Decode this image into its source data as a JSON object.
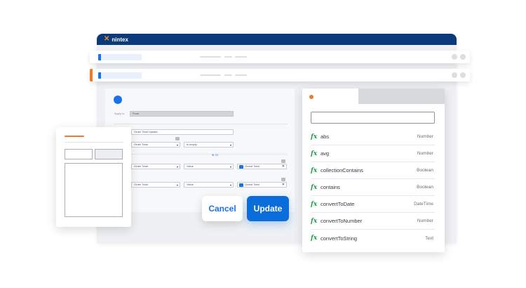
{
  "brand": {
    "name": "nintex",
    "mark": "✕"
  },
  "form": {
    "apply_to_label": "Apply to",
    "apply_to_value": "Form",
    "rule_name": "Order Total Update",
    "rows": [
      {
        "left": "Order Total",
        "right": "is empty"
      },
      {
        "left": "Order Total",
        "middle": "Value",
        "right": "Grand Total"
      },
      {
        "left": "Order Total",
        "middle": "Value",
        "right": "Grand Total"
      }
    ],
    "link_mark": "⊕ Or"
  },
  "dialog": {
    "cancel_label": "Cancel",
    "update_label": "Update"
  },
  "functions": [
    {
      "name": "abs",
      "type": "Number"
    },
    {
      "name": "avg",
      "type": "Number"
    },
    {
      "name": "collectionContains",
      "type": "Boolean"
    },
    {
      "name": "contains",
      "type": "Boolean"
    },
    {
      "name": "convertToDate",
      "type": "DateTime"
    },
    {
      "name": "convertToNumber",
      "type": "Number"
    },
    {
      "name": "convertToString",
      "type": "Text"
    }
  ],
  "fx_symbol": "fx",
  "colors": {
    "brand_bar": "#0a3a79",
    "accent_orange": "#f07a28",
    "primary_blue": "#0a6dd9",
    "fx_green": "#2e9b4a"
  },
  "icons": {
    "caret": "▾",
    "clear": "✕"
  }
}
